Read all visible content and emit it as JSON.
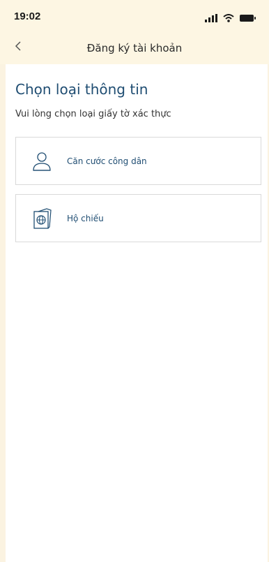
{
  "status_bar": {
    "time": "19:02"
  },
  "header": {
    "title": "Đăng ký tài khoản",
    "back_icon": "chevron-left-icon"
  },
  "main": {
    "title": "Chọn loại thông tin",
    "subtitle": "Vui lòng chọn loại giấy tờ xác thực",
    "options": [
      {
        "label": "Căn cước công dân",
        "icon": "person-icon"
      },
      {
        "label": "Hộ chiếu",
        "icon": "passport-icon"
      }
    ]
  },
  "colors": {
    "accent": "#1f4d72",
    "background": "#fbf3e1",
    "border": "#d9d9d9"
  }
}
